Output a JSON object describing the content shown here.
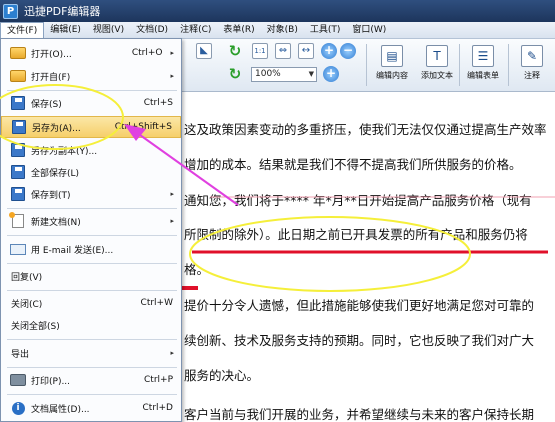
{
  "window": {
    "logo_letter": "P",
    "title": "迅捷PDF编辑器"
  },
  "menubar": {
    "items": [
      "文件(F)",
      "编辑(E)",
      "视图(V)",
      "文档(D)",
      "注释(C)",
      "表单(R)",
      "对象(B)",
      "工具(T)",
      "窗口(W)"
    ]
  },
  "toolbar": {
    "zoom_value": "100%",
    "zoom_arrow": "▼",
    "buttons": [
      {
        "label": "编辑内容",
        "icon": "edit-content-icon"
      },
      {
        "label": "添加文本",
        "icon": "add-text-icon"
      },
      {
        "label": "编辑表单",
        "icon": "edit-form-icon"
      },
      {
        "label": "注释",
        "icon": "comment-icon"
      }
    ],
    "glyphs": {
      "select": "◣",
      "refresh": "↻",
      "reload": "↻",
      "page_one": "1:1",
      "fit": "⇔",
      "fit_width": "↔",
      "zoom_in": "+",
      "zoom_out": "−",
      "zoom_in2": "+",
      "add_text": "T",
      "edit_form": "☰",
      "comment": "✎",
      "edit_content": "▤"
    }
  },
  "file_menu": {
    "submenu_arrow": "▸",
    "info_letter": "i",
    "items": [
      {
        "label": "打开(O)...",
        "shortcut": "Ctrl+O",
        "icon": "folder-open-icon",
        "submenu": true
      },
      {
        "label": "打开自(F)",
        "shortcut": "",
        "icon": "folder-open-from-icon",
        "submenu": true
      },
      {
        "label": "保存(S)",
        "shortcut": "Ctrl+S",
        "icon": "save-icon",
        "submenu": false
      },
      {
        "label": "另存为(A)...",
        "shortcut": "Ctrl+Shift+S",
        "icon": "save-as-icon",
        "submenu": false
      },
      {
        "label": "另存为副本(Y)...",
        "shortcut": "",
        "icon": "save-copy-icon",
        "submenu": false
      },
      {
        "label": "全部保存(L)",
        "shortcut": "",
        "icon": "save-all-icon",
        "submenu": false
      },
      {
        "label": "保存到(T)",
        "shortcut": "",
        "icon": "save-to-icon",
        "submenu": true
      },
      {
        "label": "新建文档(N)",
        "shortcut": "",
        "icon": "new-document-icon",
        "submenu": true
      },
      {
        "label": "用 E-mail 发送(E)...",
        "shortcut": "",
        "icon": "email-icon",
        "submenu": false
      },
      {
        "label": "回复(V)",
        "shortcut": "",
        "icon": "",
        "submenu": false
      },
      {
        "label": "关闭(C)",
        "shortcut": "Ctrl+W",
        "icon": "",
        "submenu": false
      },
      {
        "label": "关闭全部(S)",
        "shortcut": "",
        "icon": "",
        "submenu": false
      },
      {
        "label": "导出",
        "shortcut": "",
        "icon": "",
        "submenu": true
      },
      {
        "label": "打印(P)...",
        "shortcut": "Ctrl+P",
        "icon": "printer-icon",
        "submenu": false
      },
      {
        "label": "文档属性(D)...",
        "shortcut": "Ctrl+D",
        "icon": "info-icon",
        "submenu": false
      }
    ]
  },
  "document": {
    "lines": [
      "这及政策因素变动的多重挤压，使我们无法仅仅通过提高生产效率",
      "增加的成本。结果就是我们不得不提高我们所供服务的价格。",
      "通知您，我们将于**** 年*月**日开始提高产品服务价格（现有",
      "所限制的除外）。此日期之前已开具发票的所有产品和服务仍将",
      "格。",
      "提价十分令人遗憾，但此措施能够使我们更好地满足您对可靠的",
      "续创新、技术及服务支持的预期。同时，它也反映了我们对广大",
      "服务的决心。",
      "客户当前与我们开展的业务，并希望继续与未来的客户保持长期"
    ]
  },
  "colors": {
    "highlight_circle": "#f5ef3a",
    "arrow": "#e040e0",
    "underline": "#e0102a"
  }
}
